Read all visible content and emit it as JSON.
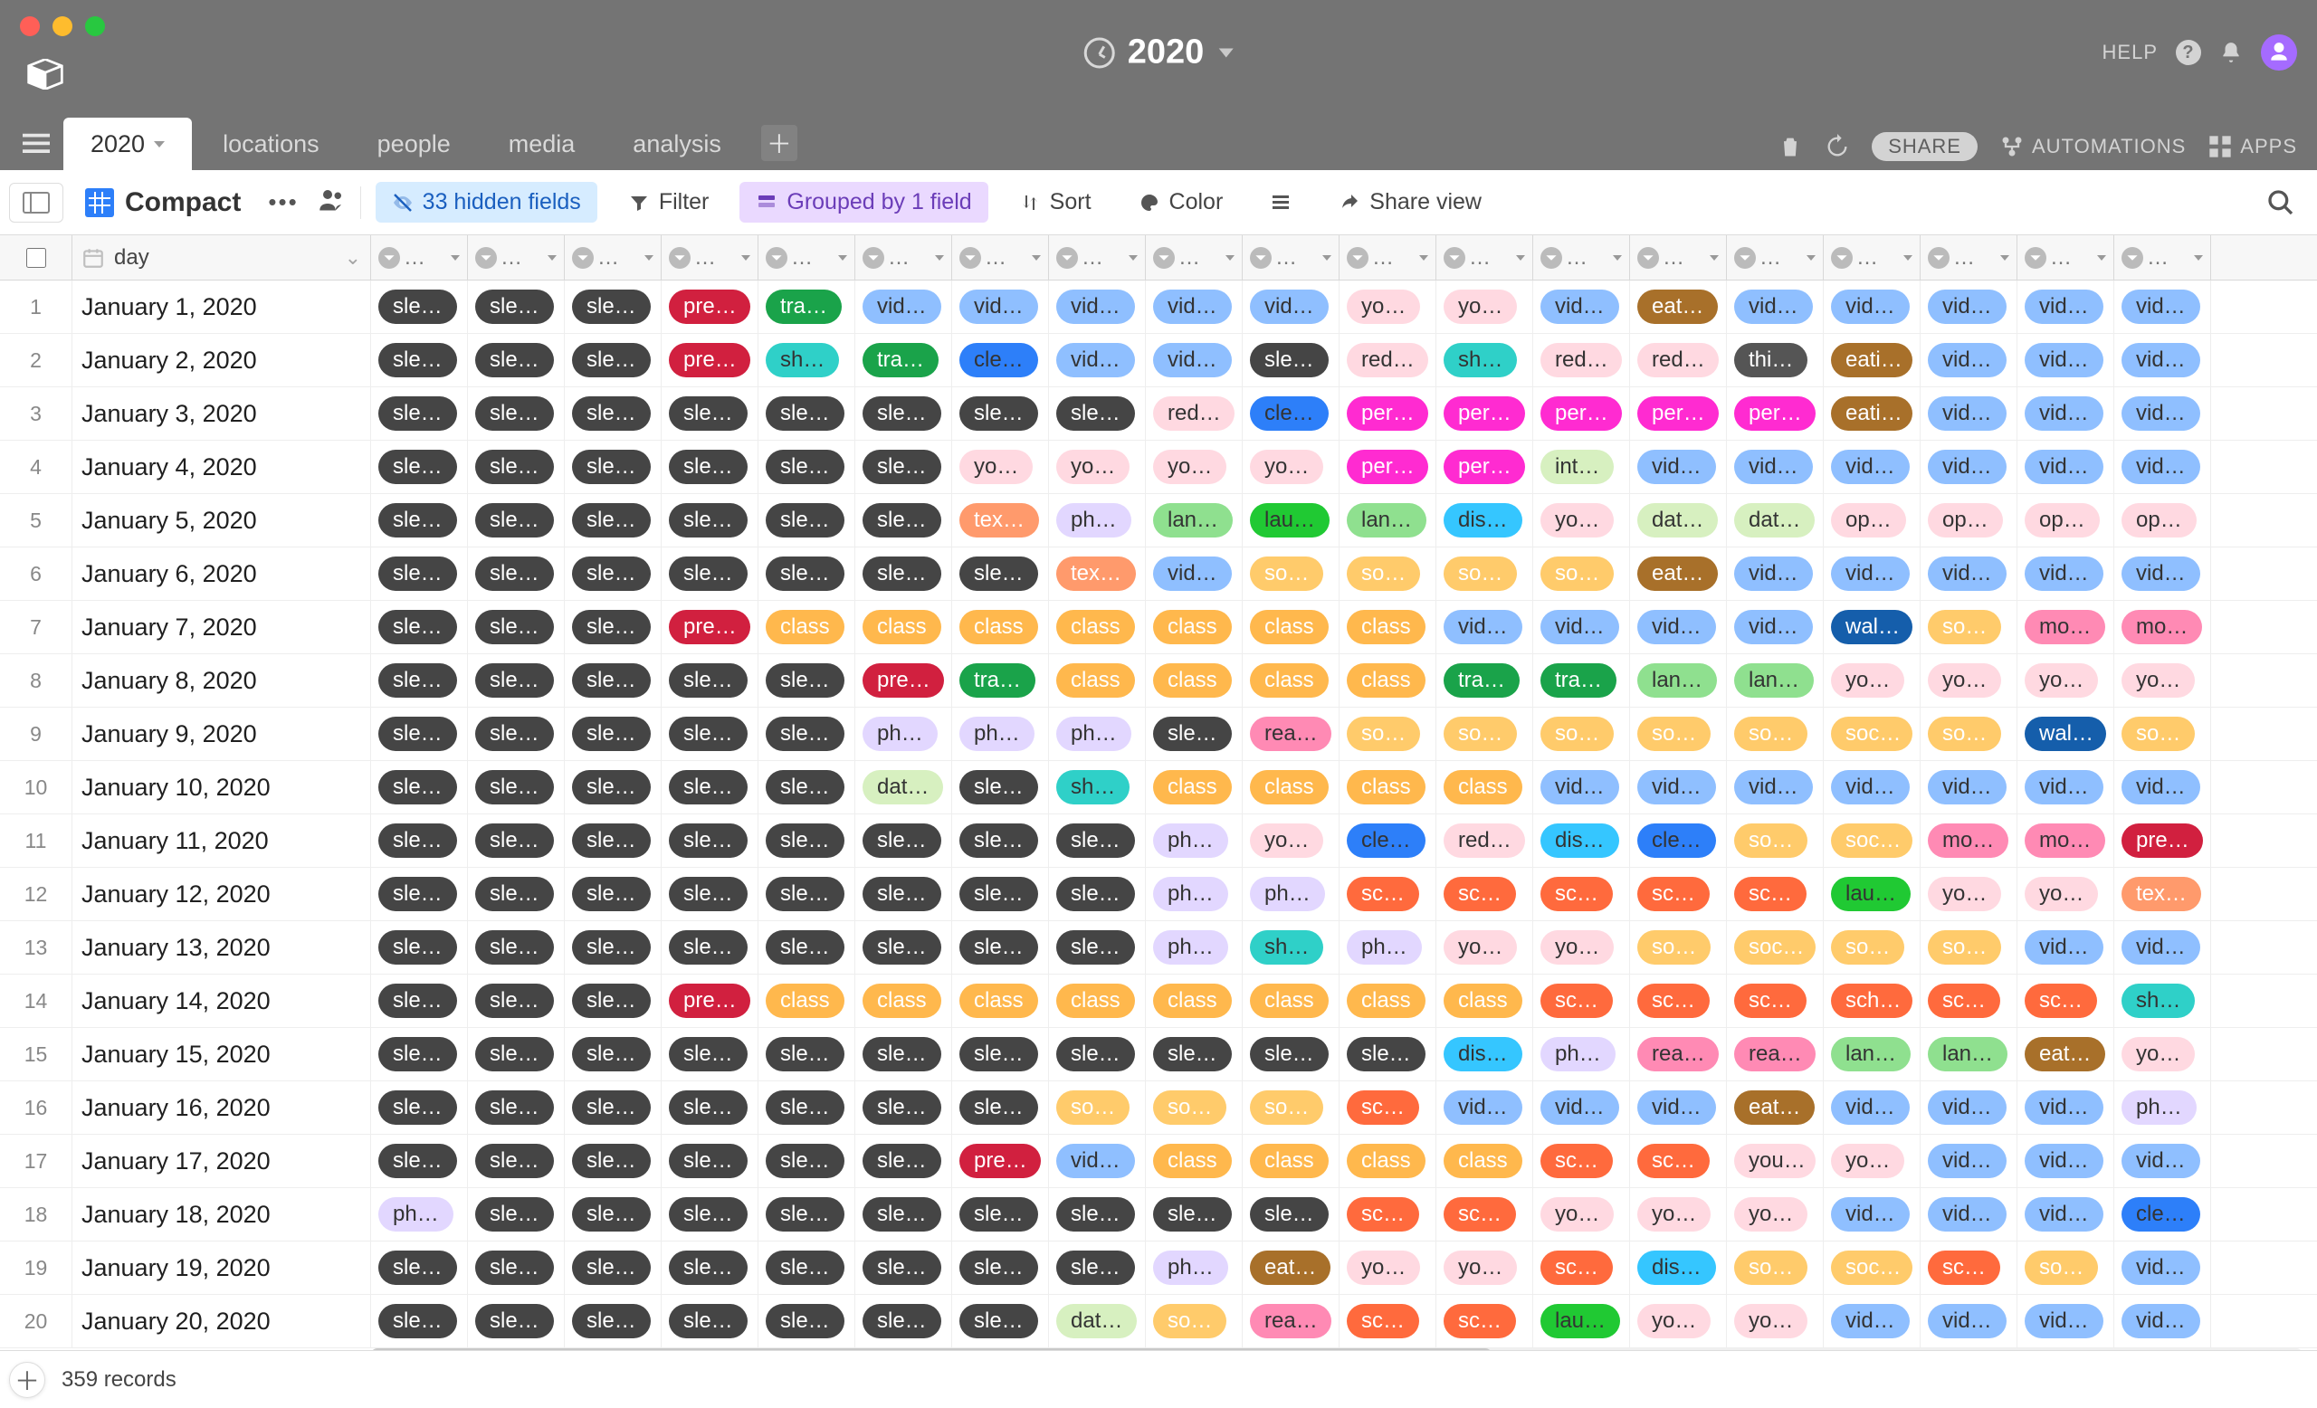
{
  "window": {
    "title": "2020"
  },
  "titlebar_right": {
    "help": "HELP"
  },
  "tabs": [
    {
      "label": "2020",
      "active": true
    },
    {
      "label": "locations"
    },
    {
      "label": "people"
    },
    {
      "label": "media"
    },
    {
      "label": "analysis"
    }
  ],
  "tabbar_right": {
    "share": "SHARE",
    "automations": "AUTOMATIONS",
    "apps": "APPS"
  },
  "view": {
    "name": "Compact"
  },
  "toolbar": {
    "hidden_fields": "33 hidden fields",
    "filter": "Filter",
    "grouped": "Grouped by 1 field",
    "sort": "Sort",
    "color": "Color",
    "share_view": "Share view"
  },
  "columns": {
    "day": "day",
    "field_placeholder": "…"
  },
  "footer": {
    "records": "359 records"
  },
  "tag_colors": {
    "sle": "#454545",
    "pre": "#d1203f",
    "tra": "#1aa34a",
    "vid": "#8fbfff",
    "yo": "#ffd9e1",
    "eat": "#a8702a",
    "eati": "#a8702a",
    "sh": "#2fd0c8",
    "cle": "#2d7ff9",
    "red": "#ffd9e1",
    "thi": "#555555",
    "per": "#ff2bd1",
    "int": "#d7f0c0",
    "tex": "#ff9a6c",
    "ph": "#e2d7ff",
    "lan": "#8fe08f",
    "lau": "#20c933",
    "dis": "#35c6ff",
    "dat": "#d7f0c0",
    "op": "#ffd9e1",
    "so": "#ffcb6b",
    "soc": "#ffcb6b",
    "class": "#ffb84d",
    "wal": "#155eab",
    "mo": "#ff8ab4",
    "rea": "#ff8ab4",
    "sc": "#ff6a3d",
    "sch": "#ff6a3d",
    "you": "#ffd9e1"
  },
  "light_tags": [
    "yo",
    "red",
    "int",
    "ph",
    "dat",
    "op",
    "lan",
    "vid",
    "you",
    "sh",
    "cle",
    "dis",
    "rea",
    "mo",
    "lau"
  ],
  "rows": [
    {
      "n": 1,
      "day": "January 1, 2020",
      "cells": [
        "sle",
        "sle",
        "sle",
        "pre",
        "tra",
        "vid",
        "vid",
        "vid",
        "vid",
        "vid",
        "yo",
        "yo",
        "vid",
        "eat",
        "vid",
        "vid",
        "vid",
        "vid",
        "vid"
      ]
    },
    {
      "n": 2,
      "day": "January 2, 2020",
      "cells": [
        "sle",
        "sle",
        "sle",
        "pre",
        "sh",
        "tra",
        "cle",
        "vid",
        "vid",
        "sle",
        "red",
        "sh",
        "red",
        "red",
        "thi",
        "eati",
        "vid",
        "vid",
        "vid"
      ]
    },
    {
      "n": 3,
      "day": "January 3, 2020",
      "cells": [
        "sle",
        "sle",
        "sle",
        "sle",
        "sle",
        "sle",
        "sle",
        "sle",
        "red",
        "cle",
        "per",
        "per",
        "per",
        "per",
        "per",
        "eati",
        "vid",
        "vid",
        "vid"
      ]
    },
    {
      "n": 4,
      "day": "January 4, 2020",
      "cells": [
        "sle",
        "sle",
        "sle",
        "sle",
        "sle",
        "sle",
        "yo",
        "yo",
        "yo",
        "yo",
        "per",
        "per",
        "int",
        "vid",
        "vid",
        "vid",
        "vid",
        "vid",
        "vid"
      ]
    },
    {
      "n": 5,
      "day": "January 5, 2020",
      "cells": [
        "sle",
        "sle",
        "sle",
        "sle",
        "sle",
        "sle",
        "tex",
        "ph",
        "lan",
        "lau",
        "lan",
        "dis",
        "yo",
        "dat",
        "dat",
        "op",
        "op",
        "op",
        "op"
      ]
    },
    {
      "n": 6,
      "day": "January 6, 2020",
      "cells": [
        "sle",
        "sle",
        "sle",
        "sle",
        "sle",
        "sle",
        "sle",
        "tex",
        "vid",
        "so",
        "so",
        "so",
        "so",
        "eat",
        "vid",
        "vid",
        "vid",
        "vid",
        "vid"
      ]
    },
    {
      "n": 7,
      "day": "January 7, 2020",
      "cells": [
        "sle",
        "sle",
        "sle",
        "pre",
        "class",
        "class",
        "class",
        "class",
        "class",
        "class",
        "class",
        "vid",
        "vid",
        "vid",
        "vid",
        "wal",
        "so",
        "mo",
        "mo"
      ]
    },
    {
      "n": 8,
      "day": "January 8, 2020",
      "cells": [
        "sle",
        "sle",
        "sle",
        "sle",
        "sle",
        "pre",
        "tra",
        "class",
        "class",
        "class",
        "class",
        "tra",
        "tra",
        "lan",
        "lan",
        "yo",
        "yo",
        "yo",
        "yo"
      ]
    },
    {
      "n": 9,
      "day": "January 9, 2020",
      "cells": [
        "sle",
        "sle",
        "sle",
        "sle",
        "sle",
        "ph",
        "ph",
        "ph",
        "sle",
        "rea",
        "so",
        "so",
        "so",
        "so",
        "so",
        "soc",
        "so",
        "wal",
        "so"
      ]
    },
    {
      "n": 10,
      "day": "January 10, 2020",
      "cells": [
        "sle",
        "sle",
        "sle",
        "sle",
        "sle",
        "dat",
        "sle",
        "sh",
        "class",
        "class",
        "class",
        "class",
        "vid",
        "vid",
        "vid",
        "vid",
        "vid",
        "vid",
        "vid"
      ]
    },
    {
      "n": 11,
      "day": "January 11, 2020",
      "cells": [
        "sle",
        "sle",
        "sle",
        "sle",
        "sle",
        "sle",
        "sle",
        "sle",
        "ph",
        "yo",
        "cle",
        "red",
        "dis",
        "cle",
        "so",
        "soc",
        "mo",
        "mo",
        "pre"
      ]
    },
    {
      "n": 12,
      "day": "January 12, 2020",
      "cells": [
        "sle",
        "sle",
        "sle",
        "sle",
        "sle",
        "sle",
        "sle",
        "sle",
        "ph",
        "ph",
        "sc",
        "sc",
        "sc",
        "sc",
        "sc",
        "lau",
        "yo",
        "yo",
        "tex"
      ]
    },
    {
      "n": 13,
      "day": "January 13, 2020",
      "cells": [
        "sle",
        "sle",
        "sle",
        "sle",
        "sle",
        "sle",
        "sle",
        "sle",
        "ph",
        "sh",
        "ph",
        "yo",
        "yo",
        "so",
        "soc",
        "so",
        "so",
        "vid",
        "vid"
      ]
    },
    {
      "n": 14,
      "day": "January 14, 2020",
      "cells": [
        "sle",
        "sle",
        "sle",
        "pre",
        "class",
        "class",
        "class",
        "class",
        "class",
        "class",
        "class",
        "class",
        "sc",
        "sc",
        "sc",
        "sch",
        "sc",
        "sc",
        "sh"
      ]
    },
    {
      "n": 15,
      "day": "January 15, 2020",
      "cells": [
        "sle",
        "sle",
        "sle",
        "sle",
        "sle",
        "sle",
        "sle",
        "sle",
        "sle",
        "sle",
        "sle",
        "dis",
        "ph",
        "rea",
        "rea",
        "lan",
        "lan",
        "eat",
        "yo"
      ]
    },
    {
      "n": 16,
      "day": "January 16, 2020",
      "cells": [
        "sle",
        "sle",
        "sle",
        "sle",
        "sle",
        "sle",
        "sle",
        "so",
        "so",
        "so",
        "sc",
        "vid",
        "vid",
        "vid",
        "eat",
        "vid",
        "vid",
        "vid",
        "ph"
      ]
    },
    {
      "n": 17,
      "day": "January 17, 2020",
      "cells": [
        "sle",
        "sle",
        "sle",
        "sle",
        "sle",
        "sle",
        "pre",
        "vid",
        "class",
        "class",
        "class",
        "class",
        "sc",
        "sc",
        "you",
        "yo",
        "vid",
        "vid",
        "vid"
      ]
    },
    {
      "n": 18,
      "day": "January 18, 2020",
      "cells": [
        "ph",
        "sle",
        "sle",
        "sle",
        "sle",
        "sle",
        "sle",
        "sle",
        "sle",
        "sle",
        "sc",
        "sc",
        "yo",
        "yo",
        "yo",
        "vid",
        "vid",
        "vid",
        "cle"
      ]
    },
    {
      "n": 19,
      "day": "January 19, 2020",
      "cells": [
        "sle",
        "sle",
        "sle",
        "sle",
        "sle",
        "sle",
        "sle",
        "sle",
        "ph",
        "eat",
        "yo",
        "yo",
        "sc",
        "dis",
        "so",
        "soc",
        "sc",
        "so",
        "vid"
      ]
    },
    {
      "n": 20,
      "day": "January 20, 2020",
      "cells": [
        "sle",
        "sle",
        "sle",
        "sle",
        "sle",
        "sle",
        "sle",
        "dat",
        "so",
        "rea",
        "sc",
        "sc",
        "lau",
        "yo",
        "yo",
        "vid",
        "vid",
        "vid",
        "vid"
      ]
    }
  ]
}
